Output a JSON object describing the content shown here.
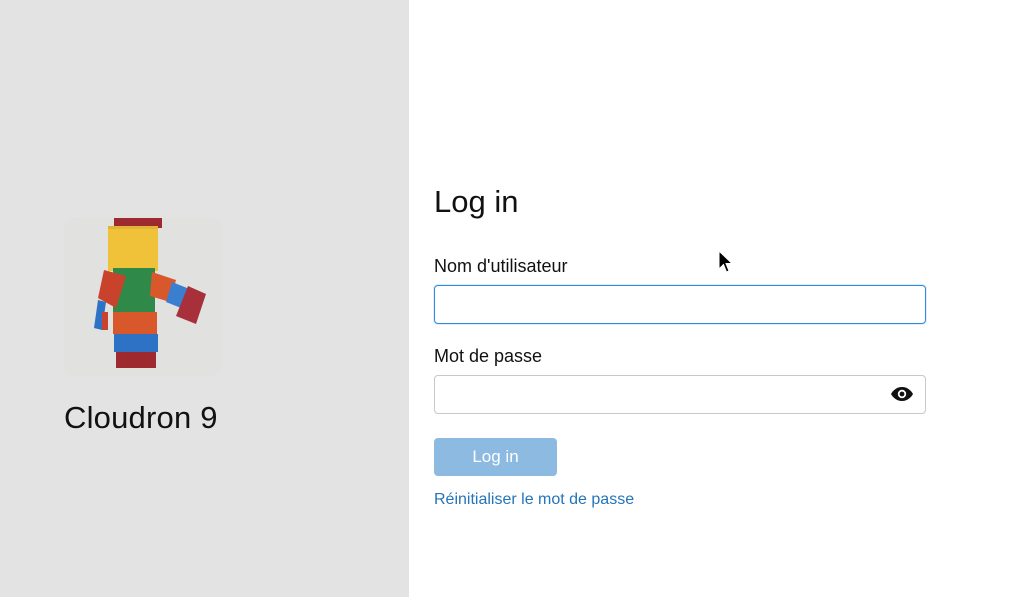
{
  "branding": {
    "server_name": "Cloudron 9",
    "logo_description": "robot-logo"
  },
  "login": {
    "title": "Log in",
    "username_label": "Nom d'utilisateur",
    "username_value": "",
    "password_label": "Mot de passe",
    "password_value": "",
    "submit_label": "Log in",
    "reset_link_label": "Réinitialiser le mot de passe"
  },
  "colors": {
    "left_panel_bg": "#e3e3e3",
    "accent": "#2a8ce0",
    "button_disabled": "#8dbae0",
    "link": "#2474b8"
  },
  "icons": {
    "password_toggle": "eye-icon"
  }
}
